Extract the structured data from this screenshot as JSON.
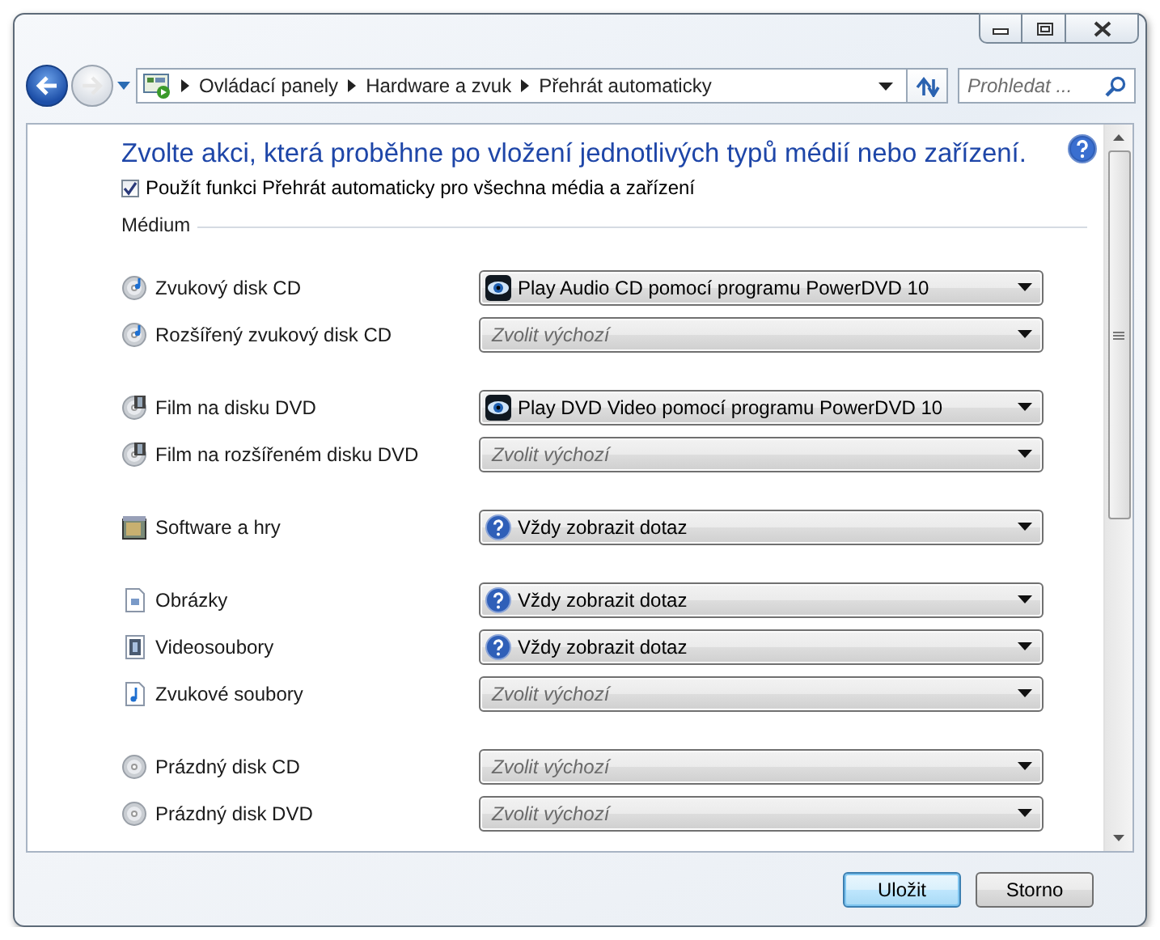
{
  "window": {
    "caption_buttons": [
      {
        "kind": "minimize"
      },
      {
        "kind": "maximize"
      },
      {
        "kind": "close"
      }
    ]
  },
  "navigation": {
    "breadcrumbs": [
      "Ovládací panely",
      "Hardware a zvuk",
      "Přehrát automaticky"
    ],
    "search": {
      "placeholder": "Prohledat ..."
    }
  },
  "heading": "Zvolte akci, která proběhne po vložení jednotlivých typů médií nebo zařízení.",
  "autoplay_all": {
    "label": "Použít funkci Přehrát automaticky pro všechna média a zařízení",
    "checked": true
  },
  "section": "Médium",
  "groups": [
    [
      {
        "label": "Zvukový disk CD",
        "kind": "app",
        "action": "Play Audio CD pomocí programu PowerDVD 10"
      },
      {
        "label": "Rozšířený zvukový disk CD",
        "kind": "default",
        "action": "Zvolit výchozí"
      }
    ],
    [
      {
        "label": "Film na disku DVD",
        "kind": "app",
        "action": "Play DVD Video pomocí programu PowerDVD 10"
      },
      {
        "label": "Film na rozšířeném disku DVD",
        "kind": "default",
        "action": "Zvolit výchozí"
      }
    ],
    [
      {
        "label": "Software a hry",
        "kind": "ask",
        "action": "Vždy zobrazit dotaz"
      }
    ],
    [
      {
        "label": "Obrázky",
        "kind": "ask",
        "action": "Vždy zobrazit dotaz"
      },
      {
        "label": "Videosoubory",
        "kind": "ask",
        "action": "Vždy zobrazit dotaz"
      },
      {
        "label": "Zvukové soubory",
        "kind": "default",
        "action": "Zvolit výchozí"
      }
    ],
    [
      {
        "label": "Prázdný disk CD",
        "kind": "default",
        "action": "Zvolit výchozí"
      },
      {
        "label": "Prázdný disk DVD",
        "kind": "default",
        "action": "Zvolit výchozí"
      }
    ]
  ],
  "buttons": [
    {
      "label": "Uložit",
      "default": true
    },
    {
      "label": "Storno",
      "default": false
    }
  ]
}
